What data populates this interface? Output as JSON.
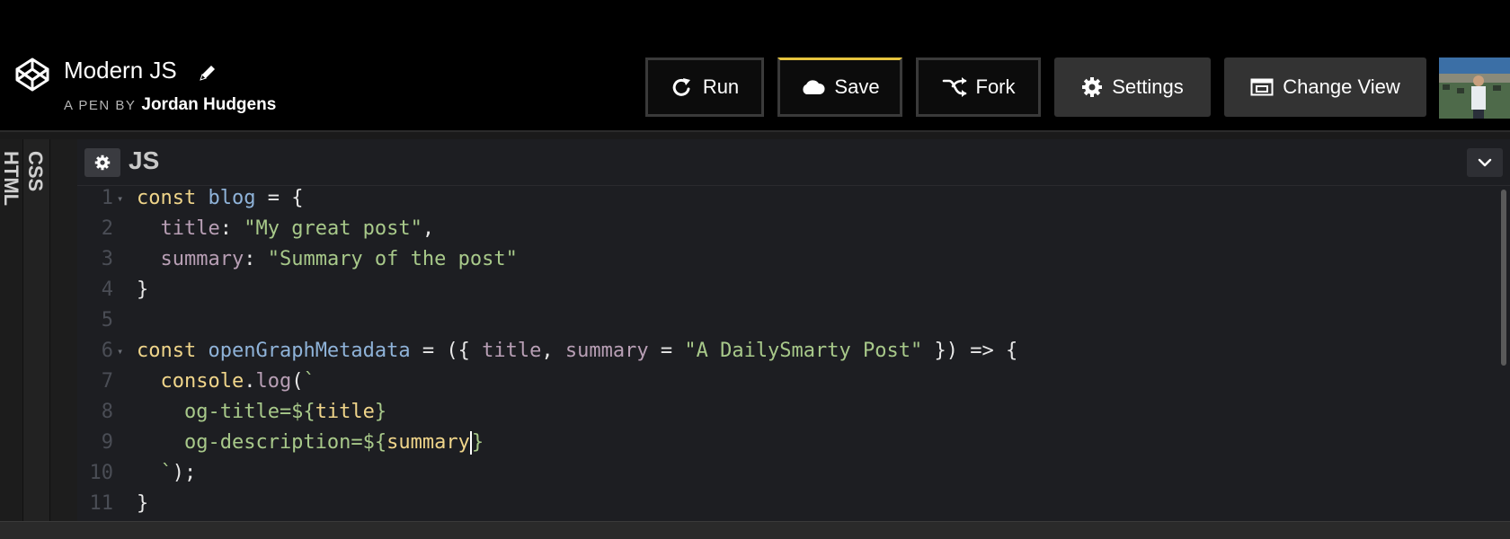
{
  "header": {
    "title": "Modern JS",
    "byline_prefix": "A PEN BY",
    "author": "Jordan Hudgens"
  },
  "toolbar": {
    "run_label": "Run",
    "save_label": "Save",
    "fork_label": "Fork",
    "settings_label": "Settings",
    "change_view_label": "Change View"
  },
  "side_tabs": {
    "html": "HTML",
    "css": "CSS"
  },
  "editor": {
    "title": "JS",
    "line_numbers": [
      "1",
      "2",
      "3",
      "4",
      "5",
      "6",
      "7",
      "8",
      "9",
      "10",
      "11"
    ],
    "lines": [
      [
        {
          "t": "kw",
          "v": "const"
        },
        {
          "t": "plain",
          "v": " "
        },
        {
          "t": "var",
          "v": "blog"
        },
        {
          "t": "plain",
          "v": " = {"
        }
      ],
      [
        {
          "t": "plain",
          "v": "  "
        },
        {
          "t": "prop",
          "v": "title"
        },
        {
          "t": "plain",
          "v": ": "
        },
        {
          "t": "str",
          "v": "\"My great post\""
        },
        {
          "t": "plain",
          "v": ","
        }
      ],
      [
        {
          "t": "plain",
          "v": "  "
        },
        {
          "t": "prop",
          "v": "summary"
        },
        {
          "t": "plain",
          "v": ": "
        },
        {
          "t": "str",
          "v": "\"Summary of the post\""
        }
      ],
      [
        {
          "t": "plain",
          "v": "}"
        }
      ],
      [],
      [
        {
          "t": "kw",
          "v": "const"
        },
        {
          "t": "plain",
          "v": " "
        },
        {
          "t": "var",
          "v": "openGraphMetadata"
        },
        {
          "t": "plain",
          "v": " = ({ "
        },
        {
          "t": "prop",
          "v": "title"
        },
        {
          "t": "plain",
          "v": ", "
        },
        {
          "t": "prop",
          "v": "summary"
        },
        {
          "t": "plain",
          "v": " = "
        },
        {
          "t": "str",
          "v": "\"A DailySmarty Post\""
        },
        {
          "t": "plain",
          "v": " }) => {"
        }
      ],
      [
        {
          "t": "plain",
          "v": "  "
        },
        {
          "t": "ident",
          "v": "console"
        },
        {
          "t": "plain",
          "v": "."
        },
        {
          "t": "prop",
          "v": "log"
        },
        {
          "t": "plain",
          "v": "("
        },
        {
          "t": "tpl",
          "v": "`"
        }
      ],
      [
        {
          "t": "tpl",
          "v": "    og-title=${"
        },
        {
          "t": "tplvar",
          "v": "title"
        },
        {
          "t": "tpl",
          "v": "}"
        }
      ],
      [
        {
          "t": "tpl",
          "v": "    og-description=${"
        },
        {
          "t": "tplvar",
          "v": "summary"
        },
        {
          "t": "cursor",
          "v": ""
        },
        {
          "t": "tpl",
          "v": "}"
        }
      ],
      [
        {
          "t": "tpl",
          "v": "  `"
        },
        {
          "t": "plain",
          "v": ");"
        }
      ],
      [
        {
          "t": "plain",
          "v": "}"
        }
      ]
    ],
    "foldable_lines": [
      1,
      6
    ]
  },
  "colors": {
    "background": "#000000",
    "editor_bg": "#1d1e22",
    "save_accent": "#e6c43e",
    "keyword": "#f0d58a",
    "variable": "#8fb3d9",
    "property": "#b89fb5",
    "string": "#a8c98a"
  },
  "icons": {
    "logo": "codepen-logo",
    "edit": "pencil-icon",
    "run": "refresh-icon",
    "save": "cloud-icon",
    "fork": "fork-icon",
    "settings": "gear-icon",
    "change_view": "layout-icon",
    "collapse": "chevron-down-icon"
  }
}
